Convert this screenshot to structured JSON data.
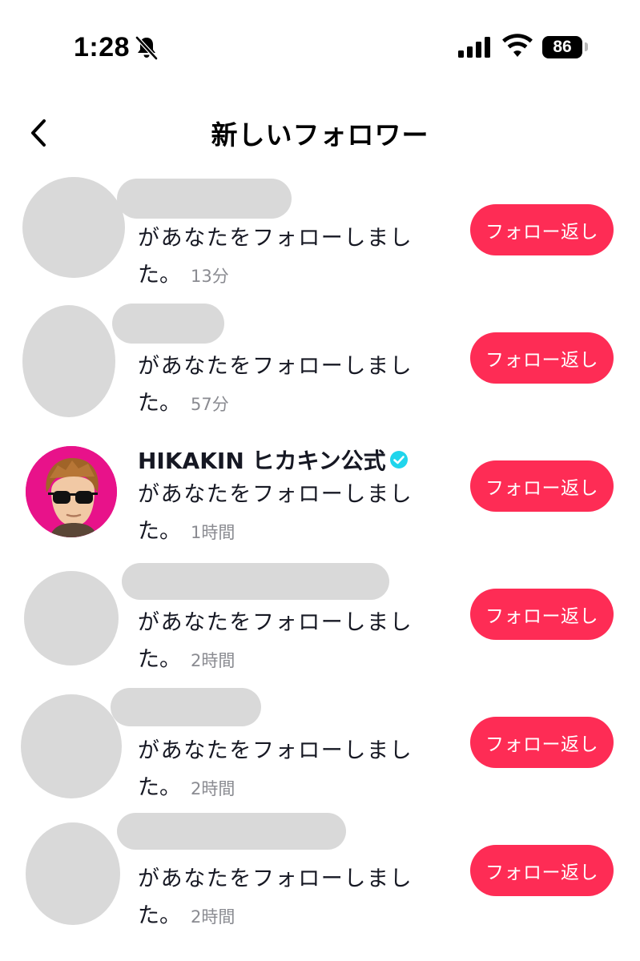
{
  "status_bar": {
    "time": "1:28",
    "battery_level": "86",
    "icons": [
      "bell-muted-icon",
      "cellular-signal-icon",
      "wifi-icon",
      "battery-icon"
    ]
  },
  "header": {
    "title": "新しいフォロワー",
    "back_icon": "chevron-left-icon"
  },
  "colors": {
    "accent": "#fe2c55",
    "verified": "#20d5ec",
    "placeholder": "#d9d9d9",
    "muted_text": "#8a8b91"
  },
  "followers": [
    {
      "name": "",
      "name_redacted": true,
      "message": "があなたをフォローしまし",
      "message_cont": "た。",
      "time": "13分",
      "button": "フォロー返し"
    },
    {
      "name": "",
      "name_redacted": true,
      "message": "があなたをフォローしまし",
      "message_cont": "た。",
      "time": "57分",
      "button": "フォロー返し"
    },
    {
      "name": "HIKAKIN ヒカキン公式",
      "name_redacted": false,
      "verified": true,
      "message": "があなたをフォローしまし",
      "message_cont": "た。",
      "time": "1時間",
      "button": "フォロー返し"
    },
    {
      "name": "",
      "name_redacted": true,
      "message": "があなたをフォローしまし",
      "message_cont": "た。",
      "time": "2時間",
      "button": "フォロー返し"
    },
    {
      "name": "",
      "name_redacted": true,
      "message": "があなたをフォローしまし",
      "message_cont": "た。",
      "time": "2時間",
      "button": "フォロー返し"
    },
    {
      "name": "",
      "name_redacted": true,
      "message": "があなたをフォローしまし",
      "message_cont": "た。",
      "time": "2時間",
      "button": "フォロー返し"
    }
  ]
}
